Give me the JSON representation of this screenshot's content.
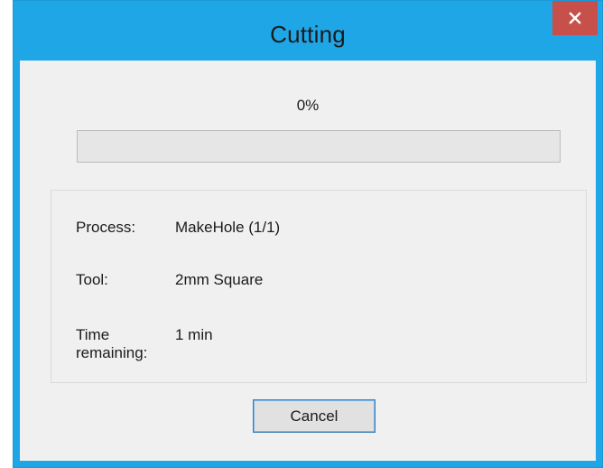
{
  "window": {
    "title": "Cutting",
    "accent_color": "#1fa6e6",
    "close_color": "#c7504a"
  },
  "progress": {
    "label": "0%",
    "value": 0
  },
  "info": {
    "process_label": "Process:",
    "process_value": "MakeHole (1/1)",
    "tool_label": "Tool:",
    "tool_value": "2mm Square",
    "time_label_line1": "Time",
    "time_label_line2": "remaining:",
    "time_value": "1 min"
  },
  "buttons": {
    "cancel_label": "Cancel"
  },
  "icons": {
    "close": "close-icon"
  }
}
